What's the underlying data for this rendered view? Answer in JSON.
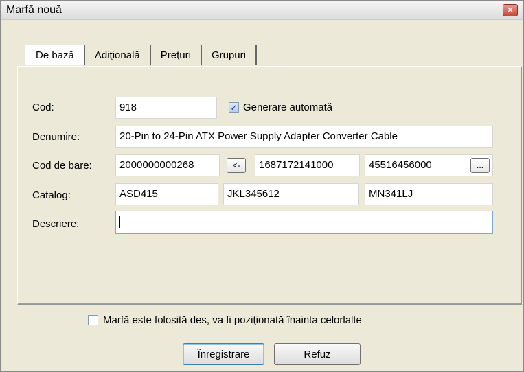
{
  "window": {
    "title": "Marfă nouă",
    "close_label": "✕"
  },
  "tabs": [
    {
      "label": "De bază",
      "active": true
    },
    {
      "label": "Adiţională",
      "active": false
    },
    {
      "label": "Preţuri",
      "active": false
    },
    {
      "label": "Grupuri",
      "active": false
    }
  ],
  "form": {
    "cod_label": "Cod:",
    "cod_value": "918",
    "auto_gen_label": "Generare automată",
    "auto_gen_checked": true,
    "denumire_label": "Denumire:",
    "denumire_value": "20-Pin to 24-Pin ATX Power Supply Adapter Converter Cable",
    "barcode_label": "Cod de bare:",
    "barcode_1": "2000000000268",
    "barcode_arrow_label": "<-",
    "barcode_2": "1687172141000",
    "barcode_3": "45516456000",
    "barcode_more_label": "...",
    "catalog_label": "Catalog:",
    "catalog_1": "ASD415",
    "catalog_2": "JKL345612",
    "catalog_3": "MN341LJ",
    "descriere_label": "Descriere:",
    "descriere_value": ""
  },
  "footer": {
    "frequent_label": "Marfă  este folosită des, va fi poziţionată înainta celorlalte",
    "frequent_checked": false,
    "save_label": "Înregistrare",
    "cancel_label": "Refuz"
  }
}
